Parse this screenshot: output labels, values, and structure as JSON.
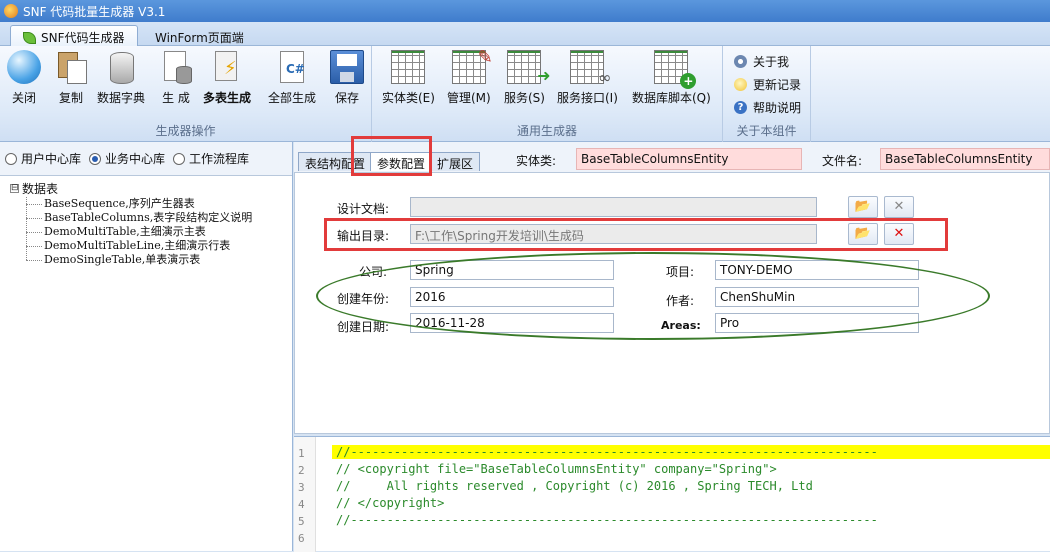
{
  "window": {
    "title": "SNF 代码批量生成器 V3.1"
  },
  "ribbon_tabs": [
    "SNF代码生成器",
    "WinForm页面端"
  ],
  "ribbon": {
    "groups": [
      {
        "label": "生成器操作"
      },
      {
        "label": "通用生成器"
      },
      {
        "label": "关于本组件"
      }
    ],
    "buttons": {
      "close": "关闭",
      "copy": "复制",
      "dictionary": "数据字典",
      "generate": "生 成",
      "multi_generate": "多表生成",
      "generate_all": "全部生成",
      "save": "保存",
      "entity": "实体类(E)",
      "manage": "管理(M)",
      "service": "服务(S)",
      "service_interface": "服务接口(I)",
      "db_script": "数据库脚本(Q)"
    },
    "about": [
      "关于我",
      "更新记录",
      "帮助说明"
    ]
  },
  "db_options": [
    {
      "label": "用户中心库",
      "selected": false
    },
    {
      "label": "业务中心库",
      "selected": true
    },
    {
      "label": "工作流程库",
      "selected": false
    }
  ],
  "tree": {
    "root": "数据表",
    "expander": "⊟",
    "items": [
      "BaseSequence,序列产生器表",
      "BaseTableColumns,表字段结构定义说明",
      "DemoMultiTable,主细演示主表",
      "DemoMultiTableLine,主细演示行表",
      "DemoSingleTable,单表演示表"
    ]
  },
  "panel_tabs": [
    "表结构配置",
    "参数配置",
    "扩展区"
  ],
  "header_fields": {
    "entity_label": "实体类:",
    "entity_value": "BaseTableColumnsEntity",
    "file_label": "文件名:",
    "file_value": "BaseTableColumnsEntity"
  },
  "form": {
    "design_doc_label": "设计文档:",
    "design_doc_value": "",
    "output_dir_label": "输出目录:",
    "output_dir_value": "F:\\工作\\Spring开发培训\\生成码",
    "company_label": "公司:",
    "company_value": "Spring",
    "project_label": "项目:",
    "project_value": "TONY-DEMO",
    "year_label": "创建年份:",
    "year_value": "2016",
    "author_label": "作者:",
    "author_value": "ChenShuMin",
    "date_label": "创建日期:",
    "date_value": "2016-11-28",
    "areas_label": "Areas:",
    "areas_value": "Pro"
  },
  "editor": {
    "line_numbers": [
      "1",
      "2",
      "3",
      "4",
      "5",
      "6"
    ],
    "lines": [
      "//-------------------------------------------------------------------------",
      "// <copyright file=\"BaseTableColumnsEntity\" company=\"Spring\">",
      "//     All rights reserved , Copyright (c) 2016 , Spring TECH, Ltd",
      "// </copyright>",
      "//-------------------------------------------------------------------------",
      ""
    ]
  },
  "icons": {
    "browse": "📂",
    "clear_gray": "✕",
    "clear_red": "✕"
  },
  "colors": {
    "annotation_red": "#e23b3b",
    "annotation_green": "#3a7a2a",
    "code_highlight": "#ffff00",
    "comment_green": "#2b8a2b"
  }
}
